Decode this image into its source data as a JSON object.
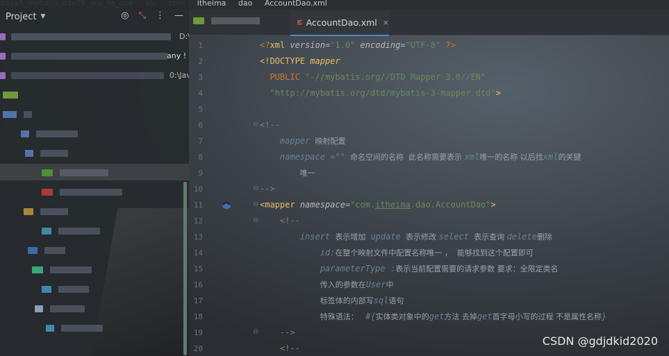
{
  "breadcrumb": [
    "daya5_mybatis_day05_one_to_one",
    "src",
    "com",
    "itheima",
    "dao",
    "AccountDao.xml"
  ],
  "project_panel": {
    "title": "Project",
    "tree_texts": [
      "D:\\",
      "any !",
      "0:\\Jav"
    ]
  },
  "tabs": [
    {
      "label": ""
    },
    {
      "label": "AccountDao.xml",
      "close": "×"
    }
  ],
  "editor": {
    "line_numbers": [
      "1",
      "2",
      "3",
      "4",
      "5",
      "6",
      "7",
      "8",
      "9",
      "10",
      "11",
      "12",
      "13",
      "14",
      "15",
      "16",
      "17",
      "18",
      "19",
      "20"
    ]
  },
  "watermark": "CSDN @gdjdkid2020",
  "icons": {
    "target": "target-icon",
    "collapse": "collapse-icon",
    "more": "more-vertical-icon",
    "minimize": "minimize-icon",
    "xml": "xml-file-icon",
    "bean": "mybatis-bean-icon"
  },
  "colors": {
    "tag": "#e8bf6a",
    "string": "#6a8759",
    "keyword": "#cc7832",
    "comment": "#808080",
    "tab_underline": "#4a88c7"
  }
}
